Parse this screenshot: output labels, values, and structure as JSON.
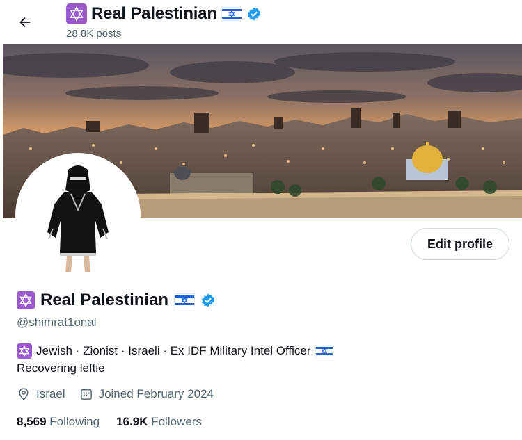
{
  "header": {
    "name": "Real Palestinian",
    "posts": "28.8K posts"
  },
  "profile": {
    "name": "Real Palestinian",
    "handle": "@shimrat1onal",
    "bio_line1": "Jewish · Zionist · Israeli · Ex IDF Military Intel Officer",
    "bio_line2": "Recovering leftie",
    "location": "Israel",
    "joined": "Joined February 2024",
    "following_count": "8,569",
    "following_label": "Following",
    "followers_count": "16.9K",
    "followers_label": "Followers"
  },
  "actions": {
    "edit_profile": "Edit profile"
  },
  "colors": {
    "star_badge": "#9b59d0",
    "verified": "#1d9bf0",
    "flag_blue": "#1f63d9"
  },
  "icons": {
    "back": "arrow-left-icon",
    "star": "star-of-david-icon",
    "verified": "verified-badge-icon",
    "location": "location-pin-icon",
    "calendar": "calendar-icon"
  }
}
